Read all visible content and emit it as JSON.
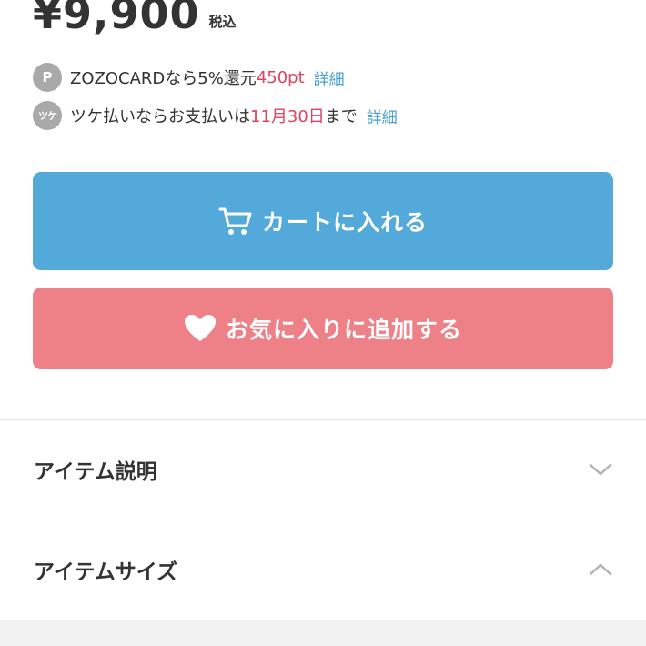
{
  "price": {
    "amount": "¥9,900",
    "tax_label": "税込"
  },
  "points": {
    "badge": "P",
    "text": "ZOZOCARDなら5%還元",
    "value": "450pt",
    "link": "詳細"
  },
  "tsuke": {
    "badge": "ツケ",
    "text": "ツケ払いならお支払いは",
    "date": "11月30日",
    "suffix": "まで",
    "link": "詳細"
  },
  "buttons": {
    "cart_label": "カートに入れる",
    "favorite_label": "お気に入りに追加する"
  },
  "accordion": [
    {
      "title": "アイテム説明",
      "state": "collapsed"
    },
    {
      "title": "アイテムサイズ",
      "state": "expanded"
    }
  ],
  "colors": {
    "cart_button": "#54a9db",
    "favorite_button": "#ee8088",
    "highlight": "#e0425e",
    "link": "#4aa1d6",
    "badge": "#a9a9a9"
  },
  "icons": {
    "cart": "cart-icon",
    "favorite": "heart-icon",
    "collapsed": "chevron-down-icon",
    "expanded": "chevron-up-icon"
  }
}
